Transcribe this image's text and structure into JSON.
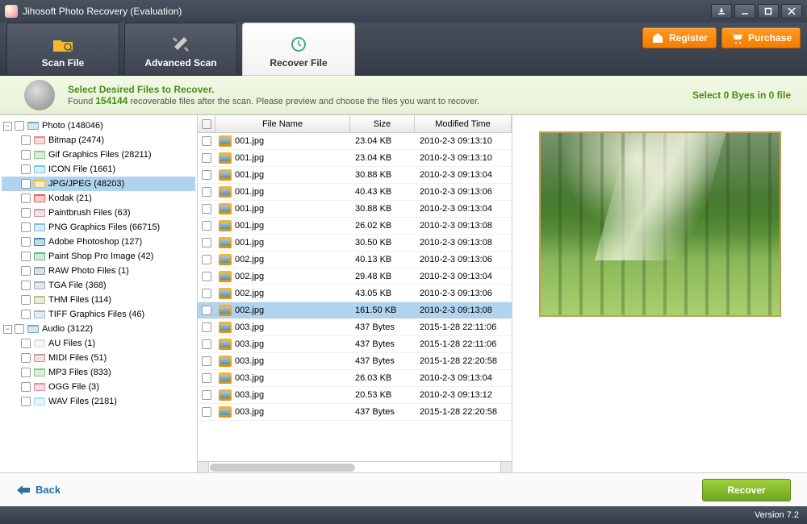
{
  "window": {
    "title": "Jihosoft Photo Recovery (Evaluation)"
  },
  "toolbar": {
    "tab_scan": "Scan File",
    "tab_advanced": "Advanced Scan",
    "tab_recover": "Recover File",
    "register": "Register",
    "purchase": "Purchase"
  },
  "banner": {
    "heading": "Select Desired Files to Recover.",
    "text_before": "Found ",
    "count": "154144",
    "text_after": " recoverable files after the scan. Please preview and choose the files you want to recover.",
    "select_info": "Select 0 Byes in 0 file"
  },
  "tree": {
    "photo": {
      "label": "Photo (148046)",
      "expanded": true
    },
    "items": [
      "Bitmap (2474)",
      "Gif Graphics Files (28211)",
      "ICON File (1661)",
      "JPG/JPEG (48203)",
      "Kodak (21)",
      "Paintbrush Files (63)",
      "PNG Graphics Files (66715)",
      "Adobe Photoshop (127)",
      "Paint Shop Pro Image (42)",
      "RAW Photo Files (1)",
      "TGA File (368)",
      "THM Files (114)",
      "TIFF Graphics Files (46)"
    ],
    "selected_index": 3,
    "audio": {
      "label": "Audio (3122)",
      "expanded": true
    },
    "audio_items": [
      "AU Files (1)",
      "MIDI Files (51)",
      "MP3 Files (833)",
      "OGG File (3)",
      "WAV Files (2181)"
    ]
  },
  "filelist": {
    "headers": {
      "name": "File Name",
      "size": "Size",
      "modified": "Modified Time"
    },
    "rows": [
      {
        "name": "001.jpg",
        "size": "23.04 KB",
        "modified": "2010-2-3 09:13:10"
      },
      {
        "name": "001.jpg",
        "size": "23.04 KB",
        "modified": "2010-2-3 09:13:10"
      },
      {
        "name": "001.jpg",
        "size": "30.88 KB",
        "modified": "2010-2-3 09:13:04"
      },
      {
        "name": "001.jpg",
        "size": "40.43 KB",
        "modified": "2010-2-3 09:13:06"
      },
      {
        "name": "001.jpg",
        "size": "30.88 KB",
        "modified": "2010-2-3 09:13:04"
      },
      {
        "name": "001.jpg",
        "size": "26.02 KB",
        "modified": "2010-2-3 09:13:08"
      },
      {
        "name": "001.jpg",
        "size": "30.50 KB",
        "modified": "2010-2-3 09:13:08"
      },
      {
        "name": "002.jpg",
        "size": "40.13 KB",
        "modified": "2010-2-3 09:13:06"
      },
      {
        "name": "002.jpg",
        "size": "29.48 KB",
        "modified": "2010-2-3 09:13:04"
      },
      {
        "name": "002.jpg",
        "size": "43.05 KB",
        "modified": "2010-2-3 09:13:06"
      },
      {
        "name": "002.jpg",
        "size": "161.50 KB",
        "modified": "2010-2-3 09:13:08"
      },
      {
        "name": "003.jpg",
        "size": "437 Bytes",
        "modified": "2015-1-28 22:11:06"
      },
      {
        "name": "003.jpg",
        "size": "437 Bytes",
        "modified": "2015-1-28 22:11:06"
      },
      {
        "name": "003.jpg",
        "size": "437 Bytes",
        "modified": "2015-1-28 22:20:58"
      },
      {
        "name": "003.jpg",
        "size": "26.03 KB",
        "modified": "2010-2-3 09:13:04"
      },
      {
        "name": "003.jpg",
        "size": "20.53 KB",
        "modified": "2010-2-3 09:13:12"
      },
      {
        "name": "003.jpg",
        "size": "437 Bytes",
        "modified": "2015-1-28 22:20:58"
      }
    ],
    "selected_index": 10
  },
  "bottom": {
    "back": "Back",
    "recover": "Recover"
  },
  "status": {
    "version": "Version 7.2"
  }
}
